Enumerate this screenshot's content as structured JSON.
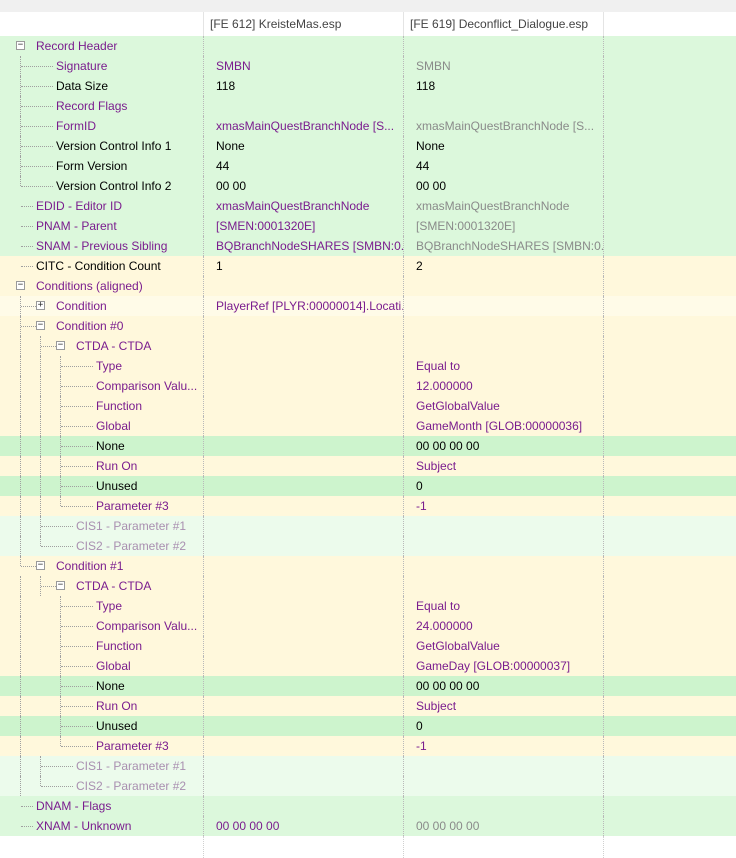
{
  "columns": [
    {
      "label": ""
    },
    {
      "label": "[FE 612] KreisteMas.esp"
    },
    {
      "label": "[FE 619] Deconflict_Dialogue.esp"
    },
    {
      "label": ""
    }
  ],
  "rows": [
    {
      "label": "Record Header",
      "depth": 0,
      "toggle": "−",
      "lc": "purple",
      "v1": "",
      "v2": "",
      "c1": "",
      "c2": "",
      "bg": "green"
    },
    {
      "label": "Signature",
      "depth": 1,
      "lc": "purple",
      "v1": "SMBN",
      "v2": "SMBN",
      "c1": "purple",
      "c2": "gray",
      "bg": "green"
    },
    {
      "label": "Data Size",
      "depth": 1,
      "lc": "black",
      "v1": "118",
      "v2": "118",
      "c1": "black",
      "c2": "black",
      "bg": "green"
    },
    {
      "label": "Record Flags",
      "depth": 1,
      "lc": "purple",
      "v1": "",
      "v2": "",
      "c1": "",
      "c2": "",
      "bg": "green"
    },
    {
      "label": "FormID",
      "depth": 1,
      "lc": "purple",
      "v1": "xmasMainQuestBranchNode [S...",
      "v2": "xmasMainQuestBranchNode [S...",
      "c1": "purple",
      "c2": "gray",
      "bg": "green"
    },
    {
      "label": "Version Control Info 1",
      "depth": 1,
      "lc": "black",
      "v1": "None",
      "v2": "None",
      "c1": "black",
      "c2": "black",
      "bg": "green"
    },
    {
      "label": "Form Version",
      "depth": 1,
      "lc": "black",
      "v1": "44",
      "v2": "44",
      "c1": "black",
      "c2": "black",
      "bg": "green"
    },
    {
      "label": "Version Control Info 2",
      "depth": 1,
      "lc": "black",
      "v1": "00 00",
      "v2": "00 00",
      "c1": "black",
      "c2": "black",
      "bg": "green"
    },
    {
      "label": "EDID - Editor ID",
      "depth": 0,
      "lc": "purple",
      "v1": "xmasMainQuestBranchNode",
      "v2": "xmasMainQuestBranchNode",
      "c1": "purple",
      "c2": "gray",
      "bg": "green"
    },
    {
      "label": "PNAM - Parent",
      "depth": 0,
      "lc": "purple",
      "v1": "[SMEN:0001320E]",
      "v2": "[SMEN:0001320E]",
      "c1": "purple",
      "c2": "gray",
      "bg": "green"
    },
    {
      "label": "SNAM - Previous Sibling",
      "depth": 0,
      "lc": "purple",
      "v1": "BQBranchNodeSHARES [SMBN:0...",
      "v2": "BQBranchNodeSHARES [SMBN:0...",
      "c1": "purple",
      "c2": "gray",
      "bg": "green"
    },
    {
      "label": "CITC - Condition Count",
      "depth": 0,
      "lc": "black",
      "v1": "1",
      "v2": "2",
      "c1": "black",
      "c2": "black",
      "bg": "yellow"
    },
    {
      "label": "Conditions (aligned)",
      "depth": 0,
      "toggle": "−",
      "lc": "purple",
      "v1": "",
      "v2": "",
      "c1": "",
      "c2": "",
      "bg": "yellow"
    },
    {
      "label": "Condition",
      "depth": 1,
      "toggle": "+",
      "lc": "purple",
      "v1": "PlayerRef [PLYR:00000014].Locati...",
      "v2": "",
      "c1": "purple",
      "c2": "",
      "bg": "lyellow"
    },
    {
      "label": "Condition #0",
      "depth": 1,
      "toggle": "−",
      "lc": "purple",
      "v1": "",
      "v2": "",
      "c1": "",
      "c2": "",
      "bg": "yellow"
    },
    {
      "label": "CTDA - CTDA",
      "depth": 2,
      "toggle": "−",
      "lc": "purple",
      "v1": "",
      "v2": "",
      "c1": "",
      "c2": "",
      "bg": "yellow"
    },
    {
      "label": "Type",
      "depth": 3,
      "lc": "purple",
      "v1": "",
      "v2": "Equal to",
      "c1": "",
      "c2": "purple",
      "bg": "yellow"
    },
    {
      "label": "Comparison Valu...",
      "depth": 3,
      "lc": "purple",
      "v1": "",
      "v2": "12.000000",
      "c1": "",
      "c2": "purple",
      "bg": "yellow"
    },
    {
      "label": "Function",
      "depth": 3,
      "lc": "purple",
      "v1": "",
      "v2": "GetGlobalValue",
      "c1": "",
      "c2": "purple",
      "bg": "yellow"
    },
    {
      "label": "Global",
      "depth": 3,
      "lc": "purple",
      "v1": "",
      "v2": "GameMonth [GLOB:00000036]",
      "c1": "",
      "c2": "purple",
      "bg": "yellow"
    },
    {
      "label": "None",
      "depth": 3,
      "lc": "black",
      "v1": "",
      "v2": "00 00 00 00",
      "c1": "",
      "c2": "black",
      "bg": "dgreen"
    },
    {
      "label": "Run On",
      "depth": 3,
      "lc": "purple",
      "v1": "",
      "v2": "Subject",
      "c1": "",
      "c2": "purple",
      "bg": "yellow"
    },
    {
      "label": "Unused",
      "depth": 3,
      "lc": "black",
      "v1": "",
      "v2": "0",
      "c1": "",
      "c2": "black",
      "bg": "dgreen"
    },
    {
      "label": "Parameter #3",
      "depth": 3,
      "lc": "purple",
      "v1": "",
      "v2": "-1",
      "c1": "",
      "c2": "purple",
      "bg": "yellow"
    },
    {
      "label": "CIS1 - Parameter #1",
      "depth": 2,
      "lc": "grayp",
      "v1": "",
      "v2": "",
      "c1": "",
      "c2": "",
      "bg": "lgreen"
    },
    {
      "label": "CIS2 - Parameter #2",
      "depth": 2,
      "lc": "grayp",
      "v1": "",
      "v2": "",
      "c1": "",
      "c2": "",
      "bg": "lgreen"
    },
    {
      "label": "Condition #1",
      "depth": 1,
      "toggle": "−",
      "lc": "purple",
      "v1": "",
      "v2": "",
      "c1": "",
      "c2": "",
      "bg": "yellow"
    },
    {
      "label": "CTDA - CTDA",
      "depth": 2,
      "toggle": "−",
      "lc": "purple",
      "v1": "",
      "v2": "",
      "c1": "",
      "c2": "",
      "bg": "yellow"
    },
    {
      "label": "Type",
      "depth": 3,
      "lc": "purple",
      "v1": "",
      "v2": "Equal to",
      "c1": "",
      "c2": "purple",
      "bg": "yellow"
    },
    {
      "label": "Comparison Valu...",
      "depth": 3,
      "lc": "purple",
      "v1": "",
      "v2": "24.000000",
      "c1": "",
      "c2": "purple",
      "bg": "yellow"
    },
    {
      "label": "Function",
      "depth": 3,
      "lc": "purple",
      "v1": "",
      "v2": "GetGlobalValue",
      "c1": "",
      "c2": "purple",
      "bg": "yellow"
    },
    {
      "label": "Global",
      "depth": 3,
      "lc": "purple",
      "v1": "",
      "v2": "GameDay [GLOB:00000037]",
      "c1": "",
      "c2": "purple",
      "bg": "yellow"
    },
    {
      "label": "None",
      "depth": 3,
      "lc": "black",
      "v1": "",
      "v2": "00 00 00 00",
      "c1": "",
      "c2": "black",
      "bg": "dgreen"
    },
    {
      "label": "Run On",
      "depth": 3,
      "lc": "purple",
      "v1": "",
      "v2": "Subject",
      "c1": "",
      "c2": "purple",
      "bg": "yellow"
    },
    {
      "label": "Unused",
      "depth": 3,
      "lc": "black",
      "v1": "",
      "v2": "0",
      "c1": "",
      "c2": "black",
      "bg": "dgreen"
    },
    {
      "label": "Parameter #3",
      "depth": 3,
      "lc": "purple",
      "v1": "",
      "v2": "-1",
      "c1": "",
      "c2": "purple",
      "bg": "yellow"
    },
    {
      "label": "CIS1 - Parameter #1",
      "depth": 2,
      "lc": "grayp",
      "v1": "",
      "v2": "",
      "c1": "",
      "c2": "",
      "bg": "lgreen"
    },
    {
      "label": "CIS2 - Parameter #2",
      "depth": 2,
      "lc": "grayp",
      "v1": "",
      "v2": "",
      "c1": "",
      "c2": "",
      "bg": "lgreen"
    },
    {
      "label": "DNAM - Flags",
      "depth": 0,
      "lc": "purple",
      "v1": "",
      "v2": "",
      "c1": "",
      "c2": "",
      "bg": "green"
    },
    {
      "label": "XNAM - Unknown",
      "depth": 0,
      "lc": "purple",
      "v1": "00 00 00 00",
      "v2": "00 00 00 00",
      "c1": "purple",
      "c2": "gray",
      "bg": "green"
    }
  ],
  "icons": {
    "expanded": "minus-box-icon",
    "collapsed": "plus-box-icon"
  },
  "colors": {
    "match_row": "#dcf8dc",
    "conflict_row": "#fff8dc",
    "override_text": "#7a1c8e",
    "identical_text": "#8a8a8a"
  }
}
